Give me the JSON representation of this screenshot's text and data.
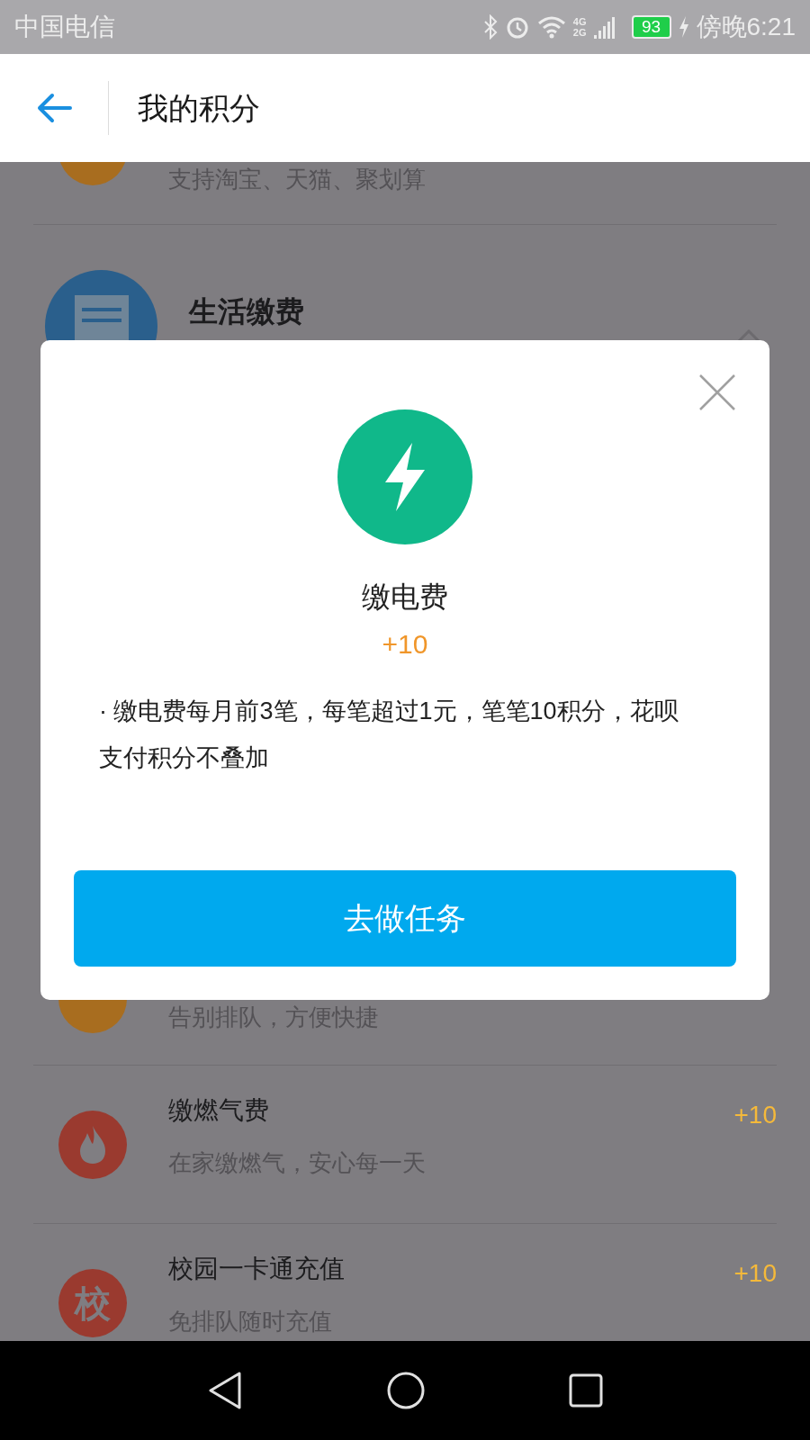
{
  "status_bar": {
    "carrier": "中国电信",
    "network_labels": [
      "4G",
      "2G"
    ],
    "battery": "93",
    "time": "傍晚6:21"
  },
  "header": {
    "title": "我的积分"
  },
  "list": {
    "top_item": {
      "color": "#a86d1f",
      "subtitle": "支持淘宝、天猫、聚划算"
    },
    "section": {
      "title": "生活缴费",
      "expanded": true
    },
    "items": [
      {
        "kind": "cut",
        "color": "#a86d1f",
        "subtitle": "告别排队，方便快捷"
      },
      {
        "kind": "fire",
        "color": "#9a3a2f",
        "title": "缴燃气费",
        "subtitle": "在家缴燃气，安心每一天",
        "points": "+10"
      },
      {
        "kind": "letter",
        "color": "#9a3a2f",
        "letter": "校",
        "title": "校园一卡通充值",
        "subtitle": "免排队随时充值",
        "points": "+10"
      }
    ]
  },
  "dialog": {
    "title": "缴电费",
    "points": "+10",
    "description": "· 缴电费每月前3笔，每笔超过1元，笔笔10积分，花呗支付积分不叠加",
    "button": "去做任务"
  }
}
